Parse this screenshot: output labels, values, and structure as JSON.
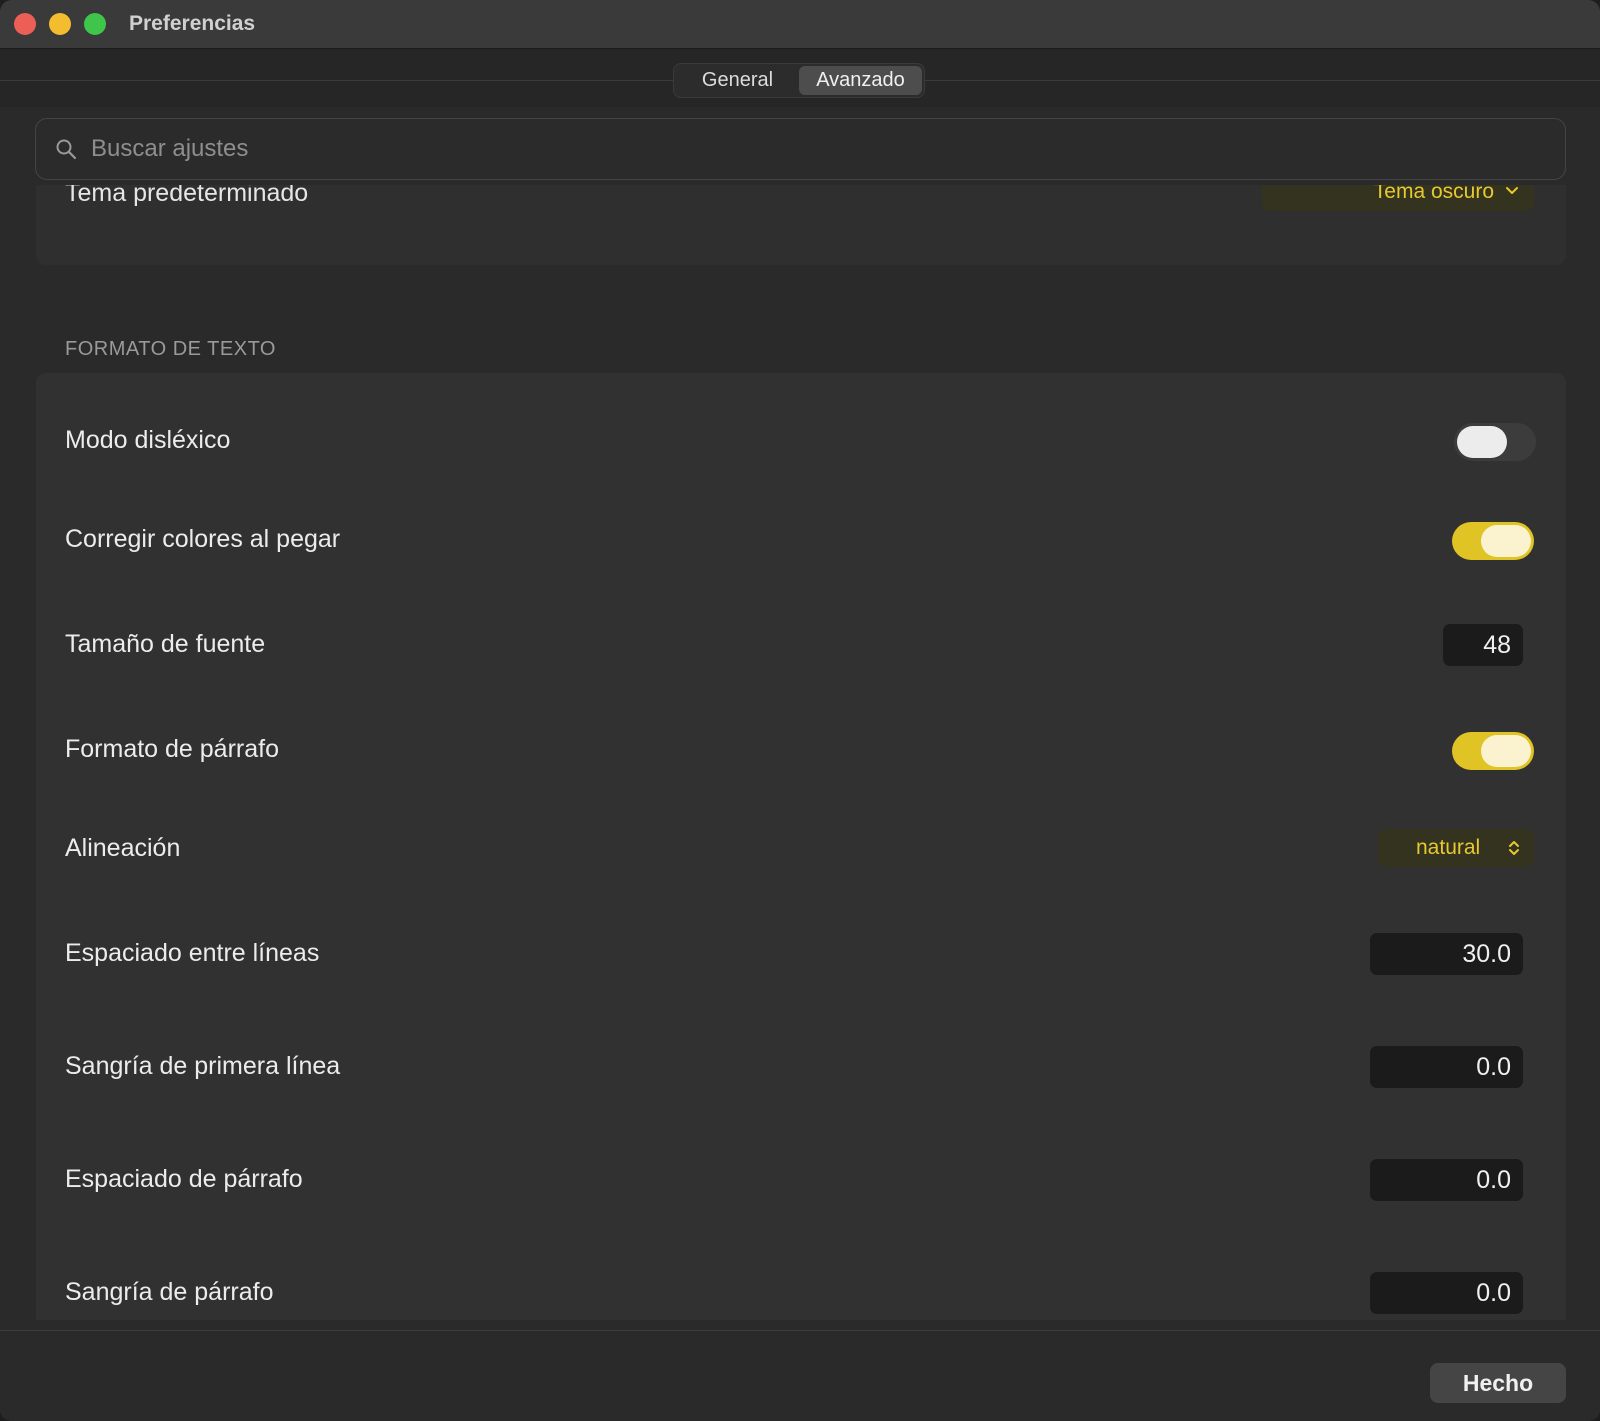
{
  "window": {
    "title": "Preferencias"
  },
  "tabs": [
    {
      "label": "General"
    },
    {
      "label": "Avanzado"
    }
  ],
  "search": {
    "placeholder": "Buscar ajustes"
  },
  "cut_row": {
    "label": "Tema predeterminado",
    "value": "Tema oscuro"
  },
  "section": {
    "title": "FORMATO DE TEXTO"
  },
  "rows": {
    "dyslexic": {
      "label": "Modo disléxico",
      "on": false
    },
    "fix_colors": {
      "label": "Corregir colores al pegar",
      "on": true
    },
    "font_size": {
      "label": "Tamaño de fuente",
      "value": "48"
    },
    "paragraph_format": {
      "label": "Formato de párrafo",
      "on": true
    },
    "alignment": {
      "label": "Alineación",
      "value": "natural"
    },
    "line_spacing": {
      "label": "Espaciado entre líneas",
      "value": "30.0"
    },
    "first_line_indent": {
      "label": "Sangría de primera línea",
      "value": "0.0"
    },
    "paragraph_spacing": {
      "label": "Espaciado de párrafo",
      "value": "0.0"
    },
    "paragraph_indent": {
      "label": "Sangría de párrafo",
      "value": "0.0"
    }
  },
  "footer": {
    "done_label": "Hecho"
  },
  "colors": {
    "accent": "#e0c325",
    "background": "#2a2a2a"
  }
}
